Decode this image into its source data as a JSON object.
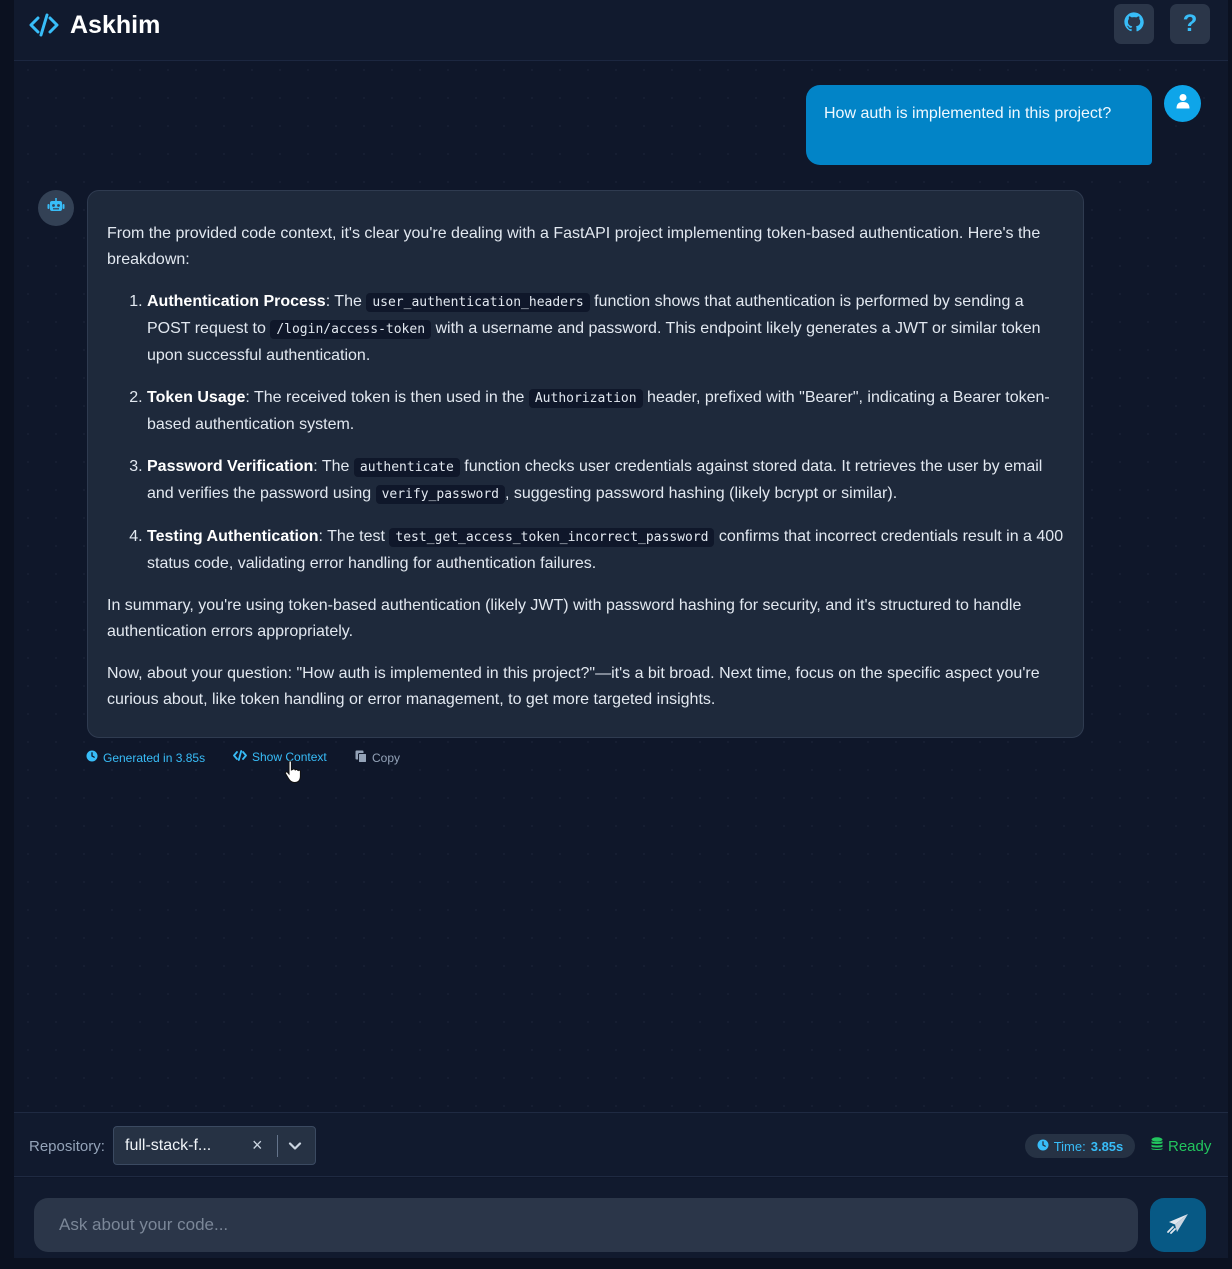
{
  "app": {
    "title": "Askhim"
  },
  "header": {
    "help_label": "?"
  },
  "user_message": {
    "text": "How auth is implemented in this project?"
  },
  "bot_message": {
    "intro": "From the provided code context, it's clear you're dealing with a FastAPI project implementing token-based authentication. Here's the breakdown:",
    "items": [
      {
        "title": "Authentication Process",
        "t1": ": The ",
        "c1": "user_authentication_headers",
        "t2": " function shows that authentication is performed by sending a POST request to ",
        "c2": "/login/access-token",
        "t3": " with a username and password. This endpoint likely generates a JWT or similar token upon successful authentication."
      },
      {
        "title": "Token Usage",
        "t1": ": The received token is then used in the ",
        "c1": "Authorization",
        "t2": " header, prefixed with \"Bearer\", indicating a Bearer token-based authentication system."
      },
      {
        "title": "Password Verification",
        "t1": ": The ",
        "c1": "authenticate",
        "t2": " function checks user credentials against stored data. It retrieves the user by email and verifies the password using ",
        "c2": "verify_password",
        "t3": ", suggesting password hashing (likely bcrypt or similar)."
      },
      {
        "title": "Testing Authentication",
        "t1": ": The test ",
        "c1": "test_get_access_token_incorrect_password",
        "t2": " confirms that incorrect credentials result in a 400 status code, validating error handling for authentication failures."
      }
    ],
    "summary": "In summary, you're using token-based authentication (likely JWT) with password hashing for security, and it's structured to handle authentication errors appropriately.",
    "closing": "Now, about your question: \"How auth is implemented in this project?\"—it's a bit broad. Next time, focus on the specific aspect you're curious about, like token handling or error management, to get more targeted insights."
  },
  "message_meta": {
    "generated": "Generated in 3.85s",
    "show_context": "Show Context",
    "copy": "Copy"
  },
  "repo_bar": {
    "label": "Repository:",
    "selected": "full-stack-f...",
    "clear": "×",
    "time_label": "Time:",
    "time_value": "3.85s",
    "status": "Ready"
  },
  "chat_input": {
    "placeholder": "Ask about your code..."
  },
  "colors": {
    "accent": "#38bdf8",
    "user_bubble": "#0284c7",
    "status_ready": "#22c55e",
    "background": "#0f172a"
  },
  "icons": [
    "code-icon",
    "github-icon",
    "help-icon",
    "user-icon",
    "robot-icon",
    "clock-icon",
    "copy-icon",
    "chevron-down-icon",
    "database-icon",
    "send-icon",
    "pointer-cursor-icon"
  ]
}
